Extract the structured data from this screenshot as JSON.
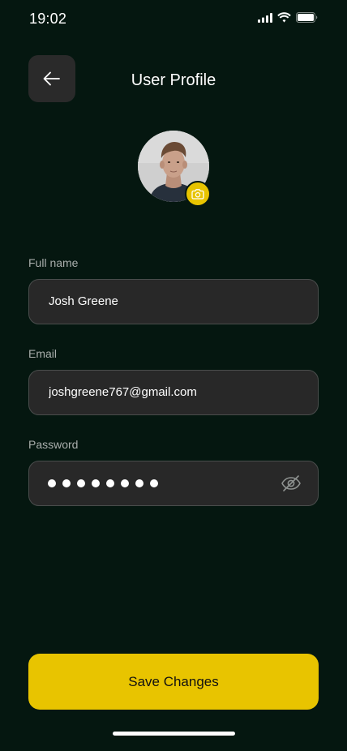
{
  "status_bar": {
    "time": "19:02",
    "icons": [
      "cellular-signal-icon",
      "wifi-icon",
      "battery-icon"
    ]
  },
  "header": {
    "title": "User Profile",
    "back_icon": "arrow-left-icon"
  },
  "avatar": {
    "badge_icon": "camera-icon"
  },
  "form": {
    "full_name": {
      "label": "Full name",
      "value": "Josh Greene"
    },
    "email": {
      "label": "Email",
      "value": "joshgreene767@gmail.com"
    },
    "password": {
      "label": "Password",
      "masked_length": 8,
      "toggle_icon": "eye-off-icon"
    }
  },
  "actions": {
    "save_label": "Save Changes"
  },
  "colors": {
    "background": "#051710",
    "accent": "#E8C400",
    "field_bg": "#282828",
    "field_border": "#4A4D4C",
    "label": "#A9AEAC"
  }
}
